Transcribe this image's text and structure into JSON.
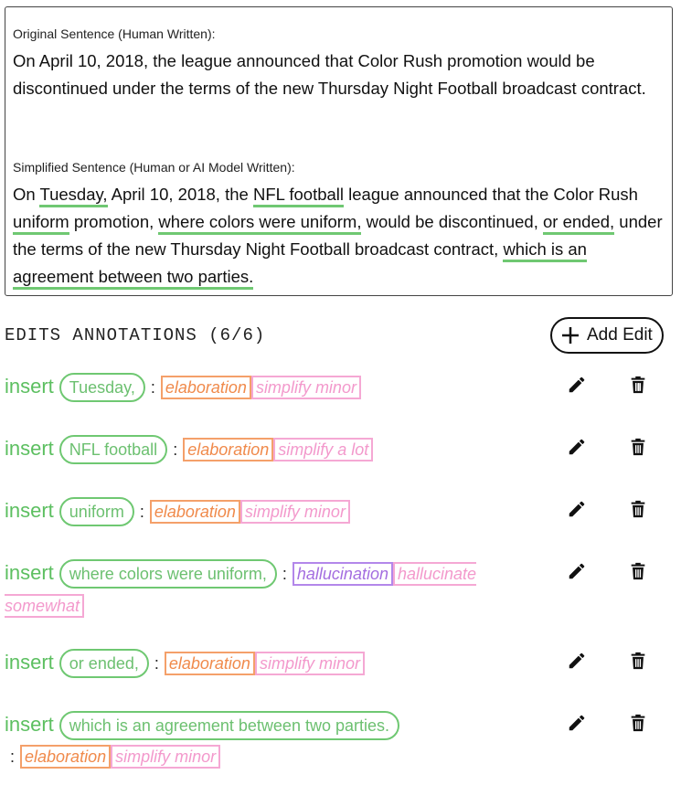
{
  "original": {
    "label": "Original Sentence (Human Written):",
    "text": "On April 10, 2018, the league announced that Color Rush promotion would be discontinued under the terms of the new Thursday Night Football broadcast contract."
  },
  "simplified": {
    "label": "Simplified Sentence (Human or AI Model Written):",
    "segments": [
      "On ",
      "Tuesday,",
      " April 10, 2018, the ",
      "NFL football",
      " league announced that the Color Rush ",
      "uniform",
      " promotion, ",
      "where colors were uniform,",
      " would be discontinued, ",
      "or ended,",
      " under the terms of the new Thursday Night Football broadcast contract, ",
      "which is an agreement between two parties."
    ]
  },
  "edits": {
    "title": "EDITS ANNOTATIONS (6/6)",
    "add_label": "Add Edit",
    "colon": ":",
    "items": [
      {
        "op": "insert",
        "text": "Tuesday,",
        "tag1": "elaboration",
        "tag2": "simplify minor"
      },
      {
        "op": "insert",
        "text": "NFL football",
        "tag1": "elaboration",
        "tag2": "simplify a lot"
      },
      {
        "op": "insert",
        "text": "uniform",
        "tag1": "elaboration",
        "tag2": "simplify minor"
      },
      {
        "op": "insert",
        "text": "where colors were uniform,",
        "tag1": "hallucination",
        "tag2": "hallucinate somewhat"
      },
      {
        "op": "insert",
        "text": "or ended,",
        "tag1": "elaboration",
        "tag2": "simplify minor"
      },
      {
        "op": "insert",
        "text": "which is an agreement between two parties.",
        "tag1": "elaboration",
        "tag2": "simplify minor"
      }
    ]
  },
  "icons": {
    "edit": "pencil-icon",
    "delete": "trash-icon",
    "add": "plus-circle-icon"
  },
  "colors": {
    "insert": "#5cbf60",
    "elaboration": "#f08a4b",
    "simplify": "#f399cc",
    "hallucination": "#a46ee0"
  }
}
